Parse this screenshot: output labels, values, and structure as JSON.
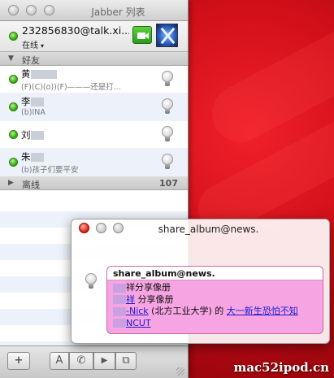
{
  "window": {
    "title": "Jabber 列表",
    "account_name": "232856830@talk.xi...",
    "account_status": "在线",
    "caret": "▾"
  },
  "groups": {
    "friends_label": "好友",
    "friends_toggle": "▼",
    "offline_label": "离线",
    "offline_toggle": "▶",
    "offline_count": "107"
  },
  "contacts": [
    {
      "name": "黄",
      "status": "(F)(C)(o))(F)———还是打..."
    },
    {
      "name": "李",
      "status": "(b)INA"
    },
    {
      "name": "刘",
      "status": ""
    },
    {
      "name": "朱",
      "status": "(b)孩子们要平安"
    }
  ],
  "toolbar": {
    "add_label": "+",
    "font_label": "A",
    "call_label": "✆",
    "video_label": "▶",
    "screen_label": "⧉"
  },
  "notification": {
    "title": "share_album@news.",
    "bubble_header": "share_album@news.",
    "line1": "祥分享像册",
    "line2_link": "祥",
    "line2_text": " 分享像册",
    "line3_link1": "-Nick",
    "line3_text": " (北方工业大学) 的 ",
    "line3_link2": "大一新生恐怕不知",
    "line4_link": "NCUT"
  },
  "watermark": "mac52ipod.cn",
  "colors": {
    "online_green": "#38b018",
    "bubble_pink": "#f6a4e2",
    "link_blue": "#1a1ad0",
    "desktop_red": "#d2101a"
  },
  "icons": {
    "presence": "green-dot-icon",
    "avatar": "x-logo-icon",
    "video": "video-camera-icon",
    "contact_status": "lightbulb-icon"
  }
}
